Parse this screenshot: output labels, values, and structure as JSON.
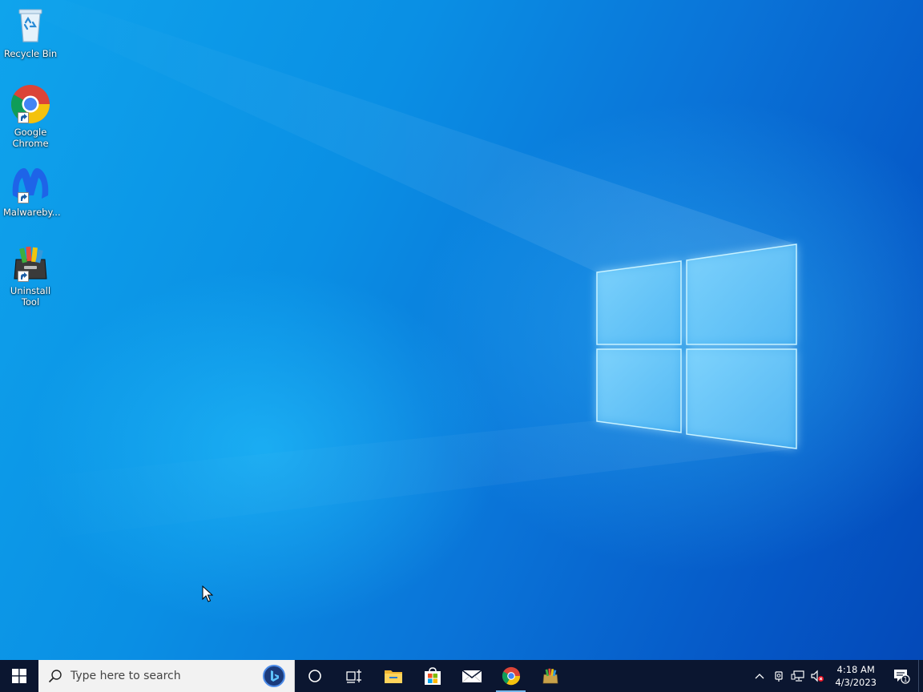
{
  "desktop": {
    "icons": [
      {
        "label": "Recycle Bin",
        "icon": "recycle-bin-icon"
      },
      {
        "label": "Google Chrome",
        "icon": "chrome-icon"
      },
      {
        "label": "Malwareby...",
        "icon": "malwarebytes-icon"
      },
      {
        "label": "Uninstall Tool",
        "icon": "uninstall-tool-icon"
      }
    ]
  },
  "taskbar": {
    "search_placeholder": "Type here to search",
    "pinned": [
      {
        "name": "cortana",
        "icon": "cortana-icon"
      },
      {
        "name": "task-view",
        "icon": "task-view-icon"
      },
      {
        "name": "file-explorer",
        "icon": "file-explorer-icon"
      },
      {
        "name": "microsoft-store",
        "icon": "store-icon"
      },
      {
        "name": "mail",
        "icon": "mail-icon"
      },
      {
        "name": "google-chrome",
        "icon": "chrome-icon"
      },
      {
        "name": "uninstall-tool",
        "icon": "uninstall-tool-icon"
      }
    ],
    "clock": {
      "time": "4:18 AM",
      "date": "4/3/2023"
    },
    "notification_count": "1"
  },
  "colors": {
    "taskbar": "#0b1630",
    "wallpaper_accent": "#0a74d8",
    "active_indicator": "#76b9ed"
  }
}
